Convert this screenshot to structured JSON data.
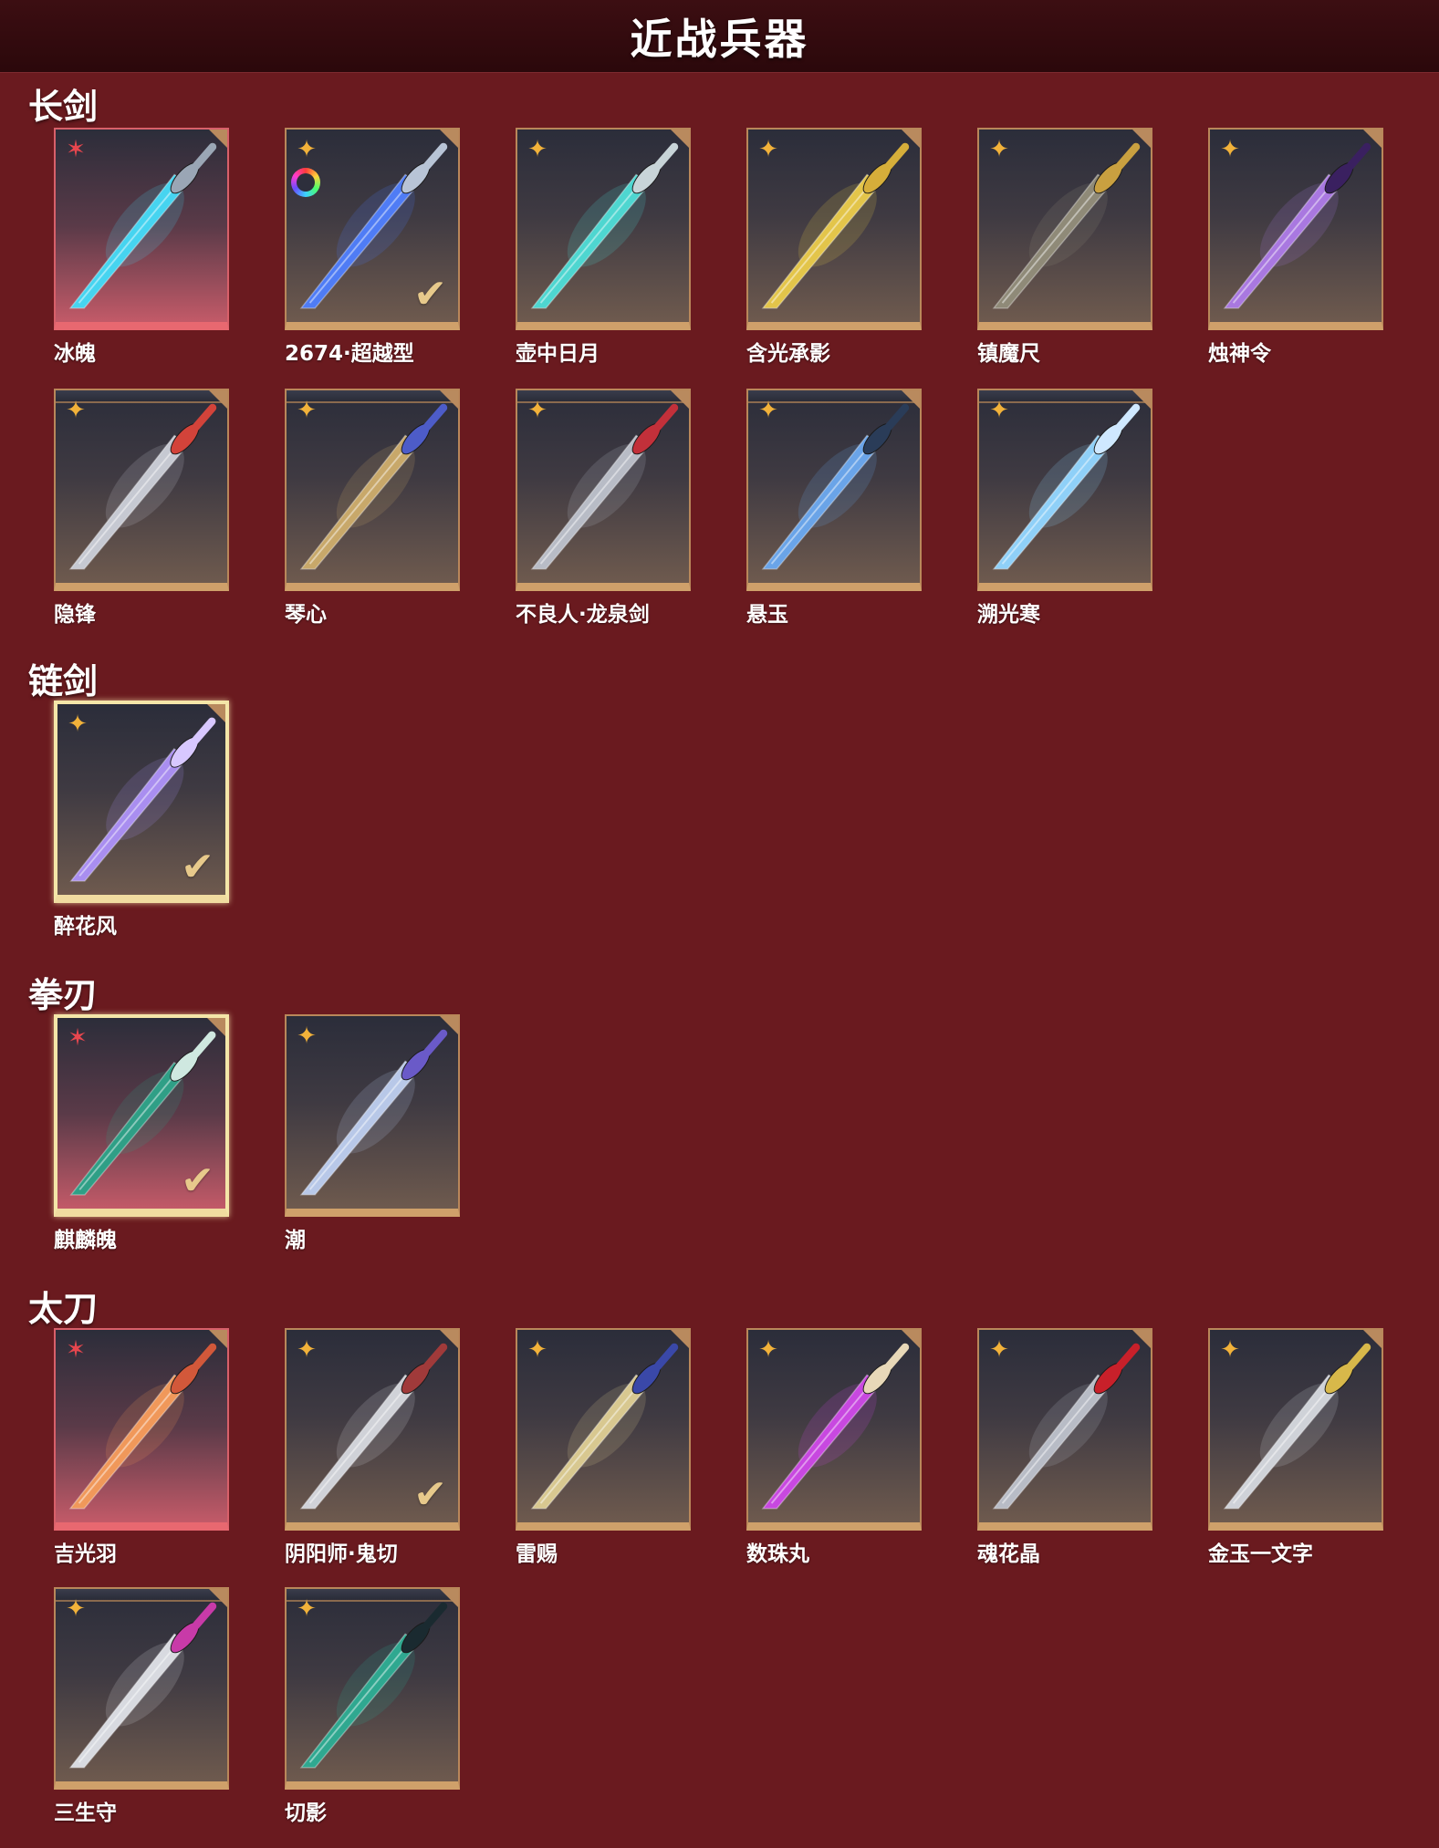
{
  "page": {
    "title": "近战兵器",
    "background": "#6a1a1f"
  },
  "sections": [
    {
      "title": "长剑",
      "items": [
        {
          "name": "冰魄",
          "rarity": "red",
          "blade": "#46d4f0",
          "hilt": "#9aa6b5"
        },
        {
          "name": "2674·超越型",
          "rarity": "gold",
          "blade": "#4f7cf5",
          "hilt": "#b8c4d6",
          "rainbow": true,
          "owned": true
        },
        {
          "name": "壶中日月",
          "rarity": "gold",
          "blade": "#4ed6d0",
          "hilt": "#c8d4d8"
        },
        {
          "name": "含光承影",
          "rarity": "gold",
          "blade": "#e3c54a",
          "hilt": "#d6ae3a"
        },
        {
          "name": "镇魔尺",
          "rarity": "gold",
          "blade": "#8f8a78",
          "hilt": "#c9a040"
        },
        {
          "name": "烛神令",
          "rarity": "gold",
          "blade": "#a978e0",
          "hilt": "#3a2060"
        },
        {
          "name": "隐锋",
          "rarity": "gold",
          "blade": "#c6c9d2",
          "hilt": "#d2433a",
          "stacked": true
        },
        {
          "name": "琴心",
          "rarity": "gold",
          "blade": "#c8a86a",
          "hilt": "#4d5cc8",
          "stacked": true
        },
        {
          "name": "不良人·龙泉剑",
          "rarity": "gold",
          "blade": "#b8bcc6",
          "hilt": "#c2303a",
          "stacked": true
        },
        {
          "name": "悬玉",
          "rarity": "gold",
          "blade": "#6aa4e8",
          "hilt": "#2a3c58",
          "stacked": true
        },
        {
          "name": "溯光寒",
          "rarity": "gold",
          "blade": "#8fd0f8",
          "hilt": "#cfe8ff",
          "stacked": true
        }
      ]
    },
    {
      "title": "链剑",
      "items": [
        {
          "name": "醉花风",
          "rarity": "gold",
          "blade": "#a98ef0",
          "hilt": "#d8c8ff",
          "owned": true,
          "selected": true
        }
      ]
    },
    {
      "title": "拳刃",
      "items": [
        {
          "name": "麒麟魄",
          "rarity": "red",
          "blade": "#2f9f86",
          "hilt": "#cfe8e0",
          "owned": true,
          "selected": true
        },
        {
          "name": "潮",
          "rarity": "gold",
          "blade": "#b8c8e8",
          "hilt": "#6a5ac8"
        }
      ]
    },
    {
      "title": "太刀",
      "items": [
        {
          "name": "吉光羽",
          "rarity": "red",
          "blade": "#f0985a",
          "hilt": "#d2583a"
        },
        {
          "name": "阴阳师·鬼切",
          "rarity": "gold",
          "blade": "#d0d2d8",
          "hilt": "#a03a3a",
          "owned": true
        },
        {
          "name": "雷赐",
          "rarity": "gold",
          "blade": "#d8c890",
          "hilt": "#3a48a8"
        },
        {
          "name": "数珠丸",
          "rarity": "gold",
          "blade": "#c848e0",
          "hilt": "#e8d8b8"
        },
        {
          "name": "魂花晶",
          "rarity": "gold",
          "blade": "#b8bcc6",
          "hilt": "#c8202a"
        },
        {
          "name": "金玉一文字",
          "rarity": "gold",
          "blade": "#cfd2d8",
          "hilt": "#d8b84a"
        },
        {
          "name": "三生守",
          "rarity": "gold",
          "blade": "#d8dae0",
          "hilt": "#c83aa8",
          "stacked": true
        },
        {
          "name": "切影",
          "rarity": "gold",
          "blade": "#2fa890",
          "hilt": "#1a2a30",
          "stacked": true
        }
      ]
    }
  ]
}
